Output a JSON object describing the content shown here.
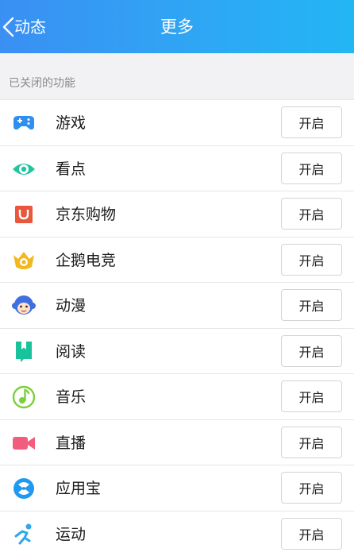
{
  "header": {
    "back_label": "动态",
    "title": "更多"
  },
  "section": {
    "title": "已关闭的功能"
  },
  "items": [
    {
      "label": "游戏",
      "action": "开启",
      "icon": "gamepad-icon",
      "color": "#2d8ff0"
    },
    {
      "label": "看点",
      "action": "开启",
      "icon": "eye-icon",
      "color": "#1fc6a0"
    },
    {
      "label": "京东购物",
      "action": "开启",
      "icon": "shopping-bag-icon",
      "color": "#e9573d"
    },
    {
      "label": "企鹅电竞",
      "action": "开启",
      "icon": "crown-icon",
      "color": "#f2b821"
    },
    {
      "label": "动漫",
      "action": "开启",
      "icon": "monkey-icon",
      "color": "#3f6fe0"
    },
    {
      "label": "阅读",
      "action": "开启",
      "icon": "book-icon",
      "color": "#18c29a"
    },
    {
      "label": "音乐",
      "action": "开启",
      "icon": "music-note-icon",
      "color": "#7ccf3a"
    },
    {
      "label": "直播",
      "action": "开启",
      "icon": "video-camera-icon",
      "color": "#f25d7b"
    },
    {
      "label": "应用宝",
      "action": "开启",
      "icon": "app-store-icon",
      "color": "#1f9af0"
    },
    {
      "label": "运动",
      "action": "开启",
      "icon": "running-icon",
      "color": "#2da7f0"
    }
  ]
}
